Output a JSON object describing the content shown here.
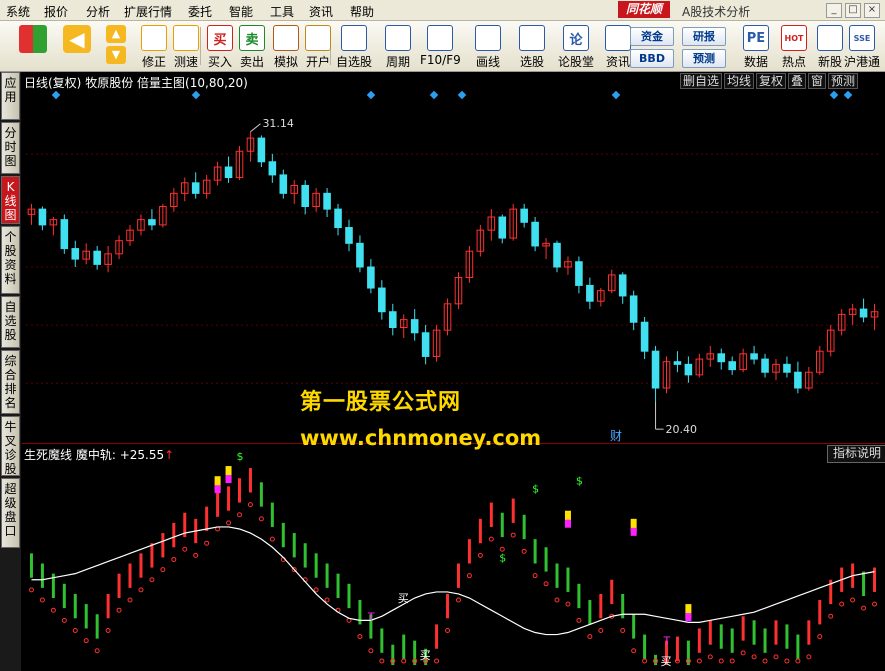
{
  "menu": {
    "items": [
      "系统",
      "报价",
      "分析",
      "扩展行情",
      "委托",
      "智能",
      "工具",
      "资讯",
      "帮助"
    ],
    "brand": "同花顺",
    "subtitle": "A股技术分析"
  },
  "window_controls": [
    "_",
    "□",
    "×"
  ],
  "toolbar": {
    "buttons": [
      {
        "label": "修正",
        "icon": "refresh-icon",
        "color": "#e8a000"
      },
      {
        "label": "测速",
        "icon": "clock-icon",
        "color": "#e8a000"
      },
      {
        "label": "买入",
        "icon": "buy-icon",
        "glyph": "买",
        "color": "#d02020"
      },
      {
        "label": "卖出",
        "icon": "sell-icon",
        "glyph": "卖",
        "color": "#1a8a2a"
      },
      {
        "label": "模拟",
        "icon": "hammer-icon",
        "color": "#b05a1a"
      },
      {
        "label": "开户",
        "icon": "lock-icon",
        "color": "#c08a1a"
      },
      {
        "label": "自选股",
        "icon": "star-folder-icon",
        "color": "#2a5aa8"
      },
      {
        "label": "周期",
        "icon": "cycle-icon",
        "color": "#2a5aa8"
      },
      {
        "label": "F10/F9",
        "icon": "f10-icon",
        "color": "#2a5aa8"
      },
      {
        "label": "画线",
        "icon": "pen-icon",
        "color": "#2a5aa8"
      },
      {
        "label": "选股",
        "icon": "screen-icon",
        "color": "#2a5aa8"
      },
      {
        "label": "论股堂",
        "icon": "discuss-icon",
        "glyph": "论",
        "color": "#2a5aa8"
      },
      {
        "label": "资讯",
        "icon": "news-icon",
        "color": "#2a5aa8"
      },
      {
        "label": "数据",
        "icon": "pe-icon",
        "glyph": "PE",
        "color": "#2a5aa8"
      },
      {
        "label": "热点",
        "icon": "hot-icon",
        "glyph": "HOT",
        "color": "#d02020"
      },
      {
        "label": "新股",
        "icon": "new-stock-icon",
        "color": "#2a5aa8"
      },
      {
        "label": "沪港通",
        "icon": "hk-connect-icon",
        "glyph": "SSE",
        "color": "#2a5aa8"
      }
    ],
    "small_buttons": [
      "资金",
      "BBD",
      "研报",
      "预测"
    ]
  },
  "left_tabs": [
    {
      "label": "应用",
      "active": false
    },
    {
      "label": "分时图",
      "active": false
    },
    {
      "label": "K线图",
      "active": true
    },
    {
      "label": "个股资料",
      "active": false
    },
    {
      "label": "自选股",
      "active": false
    },
    {
      "label": "综合排名",
      "active": false
    },
    {
      "label": "牛叉诊股",
      "active": false
    },
    {
      "label": "超级盘口",
      "active": false
    }
  ],
  "main_chart": {
    "period": "日线(复权)",
    "stock_name": "牧原股份",
    "indicator": "倍量主图(10,80,20)",
    "header_buttons": [
      "删自选",
      "均线",
      "复权",
      "叠",
      "窗",
      "预测"
    ],
    "high_label": "31.14",
    "low_label": "20.40",
    "event_marker": "财"
  },
  "sub_chart": {
    "title": "生死魔线",
    "line_name": "魔中轨:",
    "line_value": "+25.55",
    "arrow": "↑",
    "explain_button": "指标说明",
    "buy_marker": "买",
    "dollar_marker": "$",
    "t_marker": "T"
  },
  "watermark": {
    "line1": "第一股票公式网",
    "line2": "www.chnmoney.com"
  },
  "colors": {
    "up": "#ff3030",
    "down": "#40e0f0",
    "sub_green": "#30c030",
    "sub_red": "#ff3030",
    "diamond": "#2aa0f0",
    "signal_yellow": "#ffe000",
    "signal_magenta": "#ff20ff"
  },
  "chart_data": {
    "type": "candlestick",
    "ylim": [
      19.5,
      32.5
    ],
    "ohlc": [
      [
        28.0,
        28.4,
        27.6,
        28.2
      ],
      [
        28.2,
        28.3,
        27.4,
        27.6
      ],
      [
        27.6,
        27.9,
        27.2,
        27.8
      ],
      [
        27.8,
        28.0,
        26.5,
        26.7
      ],
      [
        26.7,
        27.0,
        26.0,
        26.3
      ],
      [
        26.3,
        26.9,
        26.1,
        26.6
      ],
      [
        26.6,
        26.8,
        25.9,
        26.1
      ],
      [
        26.1,
        26.8,
        25.8,
        26.5
      ],
      [
        26.5,
        27.2,
        26.3,
        27.0
      ],
      [
        27.0,
        27.6,
        26.8,
        27.4
      ],
      [
        27.4,
        28.0,
        27.2,
        27.8
      ],
      [
        27.8,
        28.2,
        27.4,
        27.6
      ],
      [
        27.6,
        28.4,
        27.5,
        28.3
      ],
      [
        28.3,
        29.0,
        28.1,
        28.8
      ],
      [
        28.8,
        29.4,
        28.5,
        29.2
      ],
      [
        29.2,
        29.6,
        28.6,
        28.8
      ],
      [
        28.8,
        29.5,
        28.6,
        29.3
      ],
      [
        29.3,
        30.0,
        29.1,
        29.8
      ],
      [
        29.8,
        30.2,
        29.2,
        29.4
      ],
      [
        29.4,
        30.6,
        29.3,
        30.4
      ],
      [
        30.4,
        31.14,
        30.0,
        30.9
      ],
      [
        30.9,
        31.0,
        29.8,
        30.0
      ],
      [
        30.0,
        30.3,
        29.2,
        29.5
      ],
      [
        29.5,
        29.7,
        28.6,
        28.8
      ],
      [
        28.8,
        29.3,
        28.4,
        29.1
      ],
      [
        29.1,
        29.3,
        28.0,
        28.3
      ],
      [
        28.3,
        29.0,
        28.1,
        28.8
      ],
      [
        28.8,
        29.0,
        27.9,
        28.2
      ],
      [
        28.2,
        28.4,
        27.2,
        27.5
      ],
      [
        27.5,
        27.8,
        26.6,
        26.9
      ],
      [
        26.9,
        27.2,
        25.8,
        26.0
      ],
      [
        26.0,
        26.3,
        25.0,
        25.2
      ],
      [
        25.2,
        25.5,
        24.0,
        24.3
      ],
      [
        24.3,
        24.6,
        23.4,
        23.7
      ],
      [
        23.7,
        24.2,
        23.3,
        24.0
      ],
      [
        24.0,
        24.4,
        23.2,
        23.5
      ],
      [
        23.5,
        23.8,
        22.3,
        22.6
      ],
      [
        22.6,
        23.8,
        22.4,
        23.6
      ],
      [
        23.6,
        24.8,
        23.4,
        24.6
      ],
      [
        24.6,
        25.8,
        24.4,
        25.6
      ],
      [
        25.6,
        26.8,
        25.4,
        26.6
      ],
      [
        26.6,
        27.6,
        26.4,
        27.4
      ],
      [
        27.4,
        28.2,
        27.0,
        27.9
      ],
      [
        27.9,
        28.0,
        26.9,
        27.1
      ],
      [
        27.1,
        28.4,
        27.0,
        28.2
      ],
      [
        28.2,
        28.4,
        27.5,
        27.7
      ],
      [
        27.7,
        27.9,
        26.6,
        26.8
      ],
      [
        26.8,
        27.1,
        26.3,
        26.9
      ],
      [
        26.9,
        27.0,
        25.8,
        26.0
      ],
      [
        26.0,
        26.4,
        25.7,
        26.2
      ],
      [
        26.2,
        26.4,
        25.0,
        25.3
      ],
      [
        25.3,
        25.6,
        24.4,
        24.7
      ],
      [
        24.7,
        25.2,
        24.5,
        25.1
      ],
      [
        25.1,
        25.9,
        25.0,
        25.7
      ],
      [
        25.7,
        25.8,
        24.6,
        24.9
      ],
      [
        24.9,
        25.1,
        23.6,
        23.9
      ],
      [
        23.9,
        24.1,
        22.5,
        22.8
      ],
      [
        22.8,
        23.0,
        20.9,
        21.4
      ],
      [
        21.4,
        22.6,
        21.2,
        22.4
      ],
      [
        22.4,
        22.8,
        22.0,
        22.3
      ],
      [
        22.3,
        22.6,
        21.6,
        21.9
      ],
      [
        21.9,
        22.7,
        21.8,
        22.5
      ],
      [
        22.5,
        23.0,
        22.2,
        22.7
      ],
      [
        22.7,
        22.9,
        22.1,
        22.4
      ],
      [
        22.4,
        22.6,
        21.9,
        22.1
      ],
      [
        22.1,
        22.9,
        22.0,
        22.7
      ],
      [
        22.7,
        23.0,
        22.3,
        22.5
      ],
      [
        22.5,
        22.7,
        21.8,
        22.0
      ],
      [
        22.0,
        22.5,
        21.7,
        22.3
      ],
      [
        22.3,
        22.6,
        21.8,
        22.0
      ],
      [
        22.0,
        22.4,
        21.2,
        21.4
      ],
      [
        21.4,
        22.2,
        21.3,
        22.0
      ],
      [
        22.0,
        23.0,
        21.9,
        22.8
      ],
      [
        22.8,
        23.8,
        22.6,
        23.6
      ],
      [
        23.6,
        24.4,
        23.4,
        24.2
      ],
      [
        24.2,
        24.6,
        23.8,
        24.4
      ],
      [
        24.4,
        24.8,
        23.9,
        24.1
      ],
      [
        24.1,
        24.6,
        23.6,
        24.3
      ]
    ],
    "sub_bars": [
      [
        0.55,
        "g"
      ],
      [
        0.5,
        "g"
      ],
      [
        0.45,
        "g"
      ],
      [
        0.4,
        "g"
      ],
      [
        0.35,
        "g"
      ],
      [
        0.3,
        "g"
      ],
      [
        0.25,
        "g"
      ],
      [
        0.35,
        "r"
      ],
      [
        0.45,
        "r"
      ],
      [
        0.5,
        "r"
      ],
      [
        0.55,
        "r"
      ],
      [
        0.6,
        "r"
      ],
      [
        0.65,
        "r"
      ],
      [
        0.7,
        "r"
      ],
      [
        0.75,
        "r"
      ],
      [
        0.72,
        "r"
      ],
      [
        0.78,
        "r"
      ],
      [
        0.85,
        "r"
      ],
      [
        0.88,
        "r"
      ],
      [
        0.92,
        "r"
      ],
      [
        0.97,
        "r"
      ],
      [
        0.9,
        "g"
      ],
      [
        0.8,
        "g"
      ],
      [
        0.7,
        "g"
      ],
      [
        0.65,
        "g"
      ],
      [
        0.6,
        "g"
      ],
      [
        0.55,
        "g"
      ],
      [
        0.5,
        "g"
      ],
      [
        0.45,
        "g"
      ],
      [
        0.4,
        "g"
      ],
      [
        0.32,
        "g"
      ],
      [
        0.25,
        "g"
      ],
      [
        0.18,
        "g"
      ],
      [
        0.1,
        "g"
      ],
      [
        0.15,
        "g"
      ],
      [
        0.12,
        "g"
      ],
      [
        0.08,
        "g"
      ],
      [
        0.2,
        "r"
      ],
      [
        0.35,
        "r"
      ],
      [
        0.5,
        "r"
      ],
      [
        0.62,
        "r"
      ],
      [
        0.72,
        "r"
      ],
      [
        0.8,
        "r"
      ],
      [
        0.75,
        "g"
      ],
      [
        0.82,
        "r"
      ],
      [
        0.74,
        "g"
      ],
      [
        0.62,
        "g"
      ],
      [
        0.58,
        "g"
      ],
      [
        0.5,
        "g"
      ],
      [
        0.48,
        "g"
      ],
      [
        0.4,
        "g"
      ],
      [
        0.32,
        "g"
      ],
      [
        0.35,
        "r"
      ],
      [
        0.42,
        "r"
      ],
      [
        0.35,
        "g"
      ],
      [
        0.25,
        "g"
      ],
      [
        0.15,
        "g"
      ],
      [
        0.05,
        "g"
      ],
      [
        0.12,
        "r"
      ],
      [
        0.14,
        "r"
      ],
      [
        0.12,
        "g"
      ],
      [
        0.18,
        "r"
      ],
      [
        0.22,
        "r"
      ],
      [
        0.2,
        "g"
      ],
      [
        0.18,
        "g"
      ],
      [
        0.24,
        "r"
      ],
      [
        0.22,
        "g"
      ],
      [
        0.18,
        "g"
      ],
      [
        0.22,
        "r"
      ],
      [
        0.2,
        "g"
      ],
      [
        0.15,
        "g"
      ],
      [
        0.22,
        "r"
      ],
      [
        0.32,
        "r"
      ],
      [
        0.42,
        "r"
      ],
      [
        0.48,
        "r"
      ],
      [
        0.5,
        "r"
      ],
      [
        0.46,
        "g"
      ],
      [
        0.48,
        "r"
      ]
    ],
    "mid_line": [
      0.42,
      0.42,
      0.43,
      0.44,
      0.45,
      0.47,
      0.49,
      0.51,
      0.53,
      0.55,
      0.57,
      0.59,
      0.61,
      0.63,
      0.65,
      0.66,
      0.67,
      0.68,
      0.68,
      0.67,
      0.65,
      0.62,
      0.58,
      0.53,
      0.47,
      0.41,
      0.35,
      0.3,
      0.26,
      0.23,
      0.22,
      0.22,
      0.24,
      0.27,
      0.3,
      0.33,
      0.35,
      0.36,
      0.36,
      0.35,
      0.33,
      0.3,
      0.27,
      0.24,
      0.21,
      0.18,
      0.16,
      0.15,
      0.15,
      0.16,
      0.18,
      0.2,
      0.22,
      0.24,
      0.25,
      0.25,
      0.25,
      0.24,
      0.23,
      0.22,
      0.21,
      0.21,
      0.22,
      0.23,
      0.24,
      0.25,
      0.26,
      0.28,
      0.3,
      0.32,
      0.34,
      0.36,
      0.38,
      0.4,
      0.42,
      0.44,
      0.45,
      0.46
    ]
  }
}
